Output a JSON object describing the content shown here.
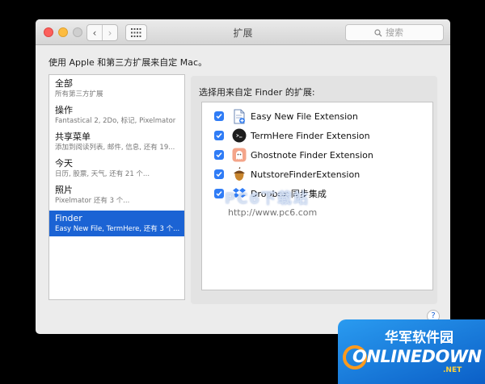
{
  "window": {
    "title": "扩展",
    "search_placeholder": "搜索"
  },
  "description": "使用 Apple 和第三方扩展来自定 Mac。",
  "sidebar": {
    "items": [
      {
        "title": "全部",
        "subtitle": "所有第三方扩展"
      },
      {
        "title": "操作",
        "subtitle": "Fantastical 2, 2Do, 标记, Pixelmator"
      },
      {
        "title": "共享菜单",
        "subtitle": "添加到阅读列表, 邮件, 信息, 还有 19..."
      },
      {
        "title": "今天",
        "subtitle": "日历, 股票, 天气, 还有 21 个..."
      },
      {
        "title": "照片",
        "subtitle": "Pixelmator 还有 3 个..."
      },
      {
        "title": "Finder",
        "subtitle": "Easy New File, TermHere, 还有 3 个..."
      }
    ],
    "selected_index": 5
  },
  "panel": {
    "header": "选择用来自定 Finder 的扩展:",
    "extensions": [
      {
        "label": "Easy New File Extension",
        "checked": true,
        "icon": "new-file-icon"
      },
      {
        "label": "TermHere Finder Extension",
        "checked": true,
        "icon": "terminal-icon"
      },
      {
        "label": "Ghostnote Finder Extension",
        "checked": true,
        "icon": "ghost-icon"
      },
      {
        "label": "NutstoreFinderExtension",
        "checked": true,
        "icon": "acorn-icon"
      },
      {
        "label": "Dropbox 同步集成",
        "checked": true,
        "icon": "dropbox-icon"
      }
    ]
  },
  "help_label": "?",
  "watermarks": {
    "pc6": "PC6下载站",
    "pc6_url": "http://www.pc6.com",
    "onlinedown_cn": "华军软件园",
    "onlinedown_en": "ONLINEDOWN",
    "onlinedown_tld": ".NET"
  }
}
